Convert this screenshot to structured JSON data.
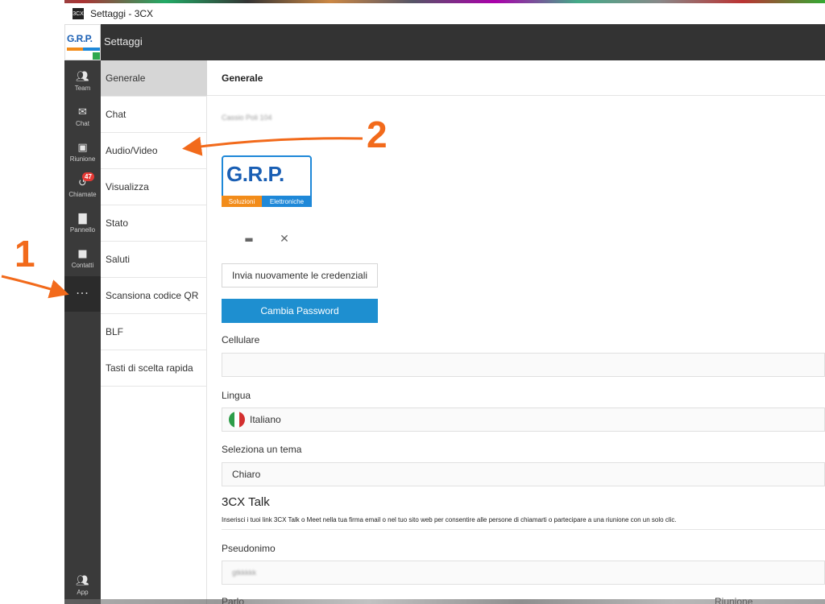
{
  "window": {
    "title": "Settaggi - 3CX",
    "app_icon_text": "3CX"
  },
  "header": {
    "title": "Settaggi",
    "logo_text": "G.R.P."
  },
  "rail": {
    "items": [
      {
        "label": "Team",
        "icon": "team-icon"
      },
      {
        "label": "Chat",
        "icon": "chat-icon"
      },
      {
        "label": "Riunione",
        "icon": "meeting-icon"
      },
      {
        "label": "Chiamate",
        "icon": "calls-icon",
        "badge": "47"
      },
      {
        "label": "Pannello",
        "icon": "panel-icon"
      },
      {
        "label": "Contatti",
        "icon": "contacts-icon"
      },
      {
        "label": "",
        "icon": "more-icon",
        "glyph": "···"
      }
    ],
    "bottom": {
      "label": "App",
      "icon": "app-icon"
    }
  },
  "menu": {
    "items": [
      "Generale",
      "Chat",
      "Audio/Video",
      "Visualizza",
      "Stato",
      "Saluti",
      "Scansiona codice QR",
      "BLF",
      "Tasti di scelta rapida"
    ],
    "active": "Generale"
  },
  "content": {
    "title": "Generale",
    "user_name": "Cassio Poli 104",
    "logo": {
      "text": "G.R.P.",
      "subtitle_left": "Soluzioni",
      "subtitle_right": "Elettroniche"
    },
    "resend_button": "Invia nuovamente le credenziali",
    "change_password_button": "Cambia Password",
    "mobile": {
      "label": "Cellulare",
      "value": ""
    },
    "language": {
      "label": "Lingua",
      "value": "Italiano"
    },
    "theme": {
      "label": "Seleziona un tema",
      "value": "Chiaro"
    },
    "talk": {
      "title": "3CX Talk",
      "description": "Inserisci i tuoi link 3CX Talk o Meet nella tua firma email o nel tuo sito web per consentire alle persone di chiamarti o partecipare a una riunione con un solo clic."
    },
    "nickname": {
      "label": "Pseudonimo",
      "value": "gtkkkkk"
    },
    "partial_bottom_left": "Parlo",
    "partial_bottom_right": "Riunione"
  },
  "annotations": {
    "one": "1",
    "two": "2"
  },
  "colors": {
    "accent_blue": "#1e8fd0",
    "annotation_orange": "#f26a1b",
    "header_dark": "#333333",
    "rail_dark": "#3a3a3a",
    "badge_red": "#e53935"
  }
}
